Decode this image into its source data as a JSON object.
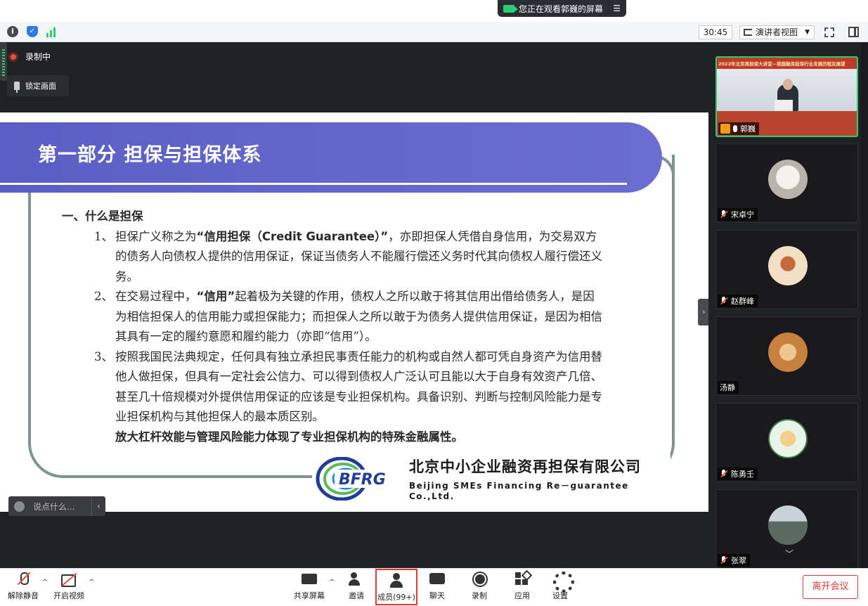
{
  "share_banner": {
    "text": "您正在观看郭巍的屏幕",
    "menu_icon": "menu-icon"
  },
  "toolbar": {
    "timer": "30:45",
    "view_mode": "演讲者视图"
  },
  "recording": {
    "label": "录制中"
  },
  "lock_view": {
    "label": "锁定画面"
  },
  "slide": {
    "title": "第一部分  担保与担保体系",
    "subtitle": "一、什么是担保",
    "paragraphs": [
      {
        "num": "1、",
        "text_a": "担保广义称之为",
        "text_bold": "“信用担保（Credit Guarantee）”",
        "text_b": "，亦即担保人凭借自身信用，为交易双方的债务人向债权人提供的信用保证，保证当债务人不能履行偿还义务时代其向债权人履行偿还义务。"
      },
      {
        "num": "2、",
        "text_a": "在交易过程中，",
        "text_bold": "“信用”",
        "text_b": "起着极为关键的作用，债权人之所以敢于将其信用出借给债务人，是因为相信担保人的信用能力或担保能力；而担保人之所以敢于为债务人提供信用保证，是因为相信其具有一定的履约意愿和履约能力（亦即“信用”）。"
      },
      {
        "num": "3、",
        "text_a": "按照我国民法典规定，任何具有独立承担民事责任能力的机构或自然人都可凭自身资产为信用替他人做担保，但具有一定社会公信力、可以得到债权人广泛认可且能以大于自身有效资产几倍、甚至几十倍规模对外提供信用保证的应该是专业担保机构。具备识别、判断与控制风险能力是专业担保机构与其他担保人的最本质区别。",
        "text_bold": "放大杠杆效能与管理风险能力体现了专业担保机构的特殊金融属性。",
        "text_b": ""
      }
    ],
    "logo_mark": "BFRG",
    "company_cn": "北京中小企业融资再担保有限公司",
    "company_en": "Beijing SMEs Financing Re－guarantee Co.,Ltd."
  },
  "chat_input": {
    "placeholder": "说点什么..."
  },
  "participants": {
    "speaker": {
      "name": "郭巍",
      "banner": "2022年北京再担保大讲堂—我国融资担保行业发展历程及展望"
    },
    "tiles": [
      {
        "name": "宋卓宁",
        "muted": true,
        "avatar_color": "#d9d6d0"
      },
      {
        "name": "赵群峰",
        "muted": true,
        "avatar_color": "#e8d2b0"
      },
      {
        "name": "汤静",
        "muted": false,
        "avatar_color": "#d69a5a"
      },
      {
        "name": "陈勇壬",
        "muted": true,
        "avatar_color": "#bfe3c8"
      },
      {
        "name": "张翠",
        "muted": true,
        "avatar_color": "#7a8a80"
      }
    ]
  },
  "bottom_bar": {
    "unmute": "解除静音",
    "video": "开启视频",
    "share": "共享屏幕",
    "invite": "邀请",
    "members": "成员(99+)",
    "chat": "聊天",
    "record": "录制",
    "apps": "应用",
    "settings": "设置",
    "leave": "离开会议"
  },
  "colors": {
    "accent_red": "#e03a3a",
    "header_purple": "#5b5ec4",
    "active_green": "#2ecc71"
  }
}
